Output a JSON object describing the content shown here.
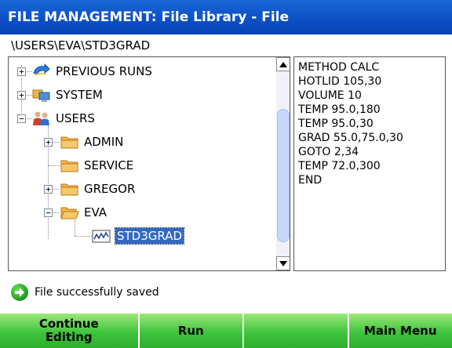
{
  "window": {
    "title": "FILE MANAGEMENT: File Library - File"
  },
  "path": "\\USERS\\EVA\\STD3GRAD",
  "tree": {
    "previous_runs": "PREVIOUS RUNS",
    "system": "SYSTEM",
    "users": "USERS",
    "admin": "ADMIN",
    "service": "SERVICE",
    "gregor": "GREGOR",
    "eva": "EVA",
    "std3grad": "STD3GRAD"
  },
  "method_lines": [
    "METHOD CALC",
    "HOTLID 105,30",
    "VOLUME 10",
    "TEMP 95.0,180",
    "TEMP 95.0,30",
    "GRAD 55.0,75.0,30",
    "GOTO 2,34",
    "TEMP 72.0,300",
    "END"
  ],
  "status": {
    "message": "File successfully saved",
    "icon": "arrow-right-icon"
  },
  "footer": {
    "continue_editing": "Continue Editing",
    "run": "Run",
    "empty": "",
    "main_menu": "Main Menu"
  },
  "colors": {
    "title_bar": "#0b4fc4",
    "selection": "#316ac5",
    "button_green": "#3fc43d",
    "folder": "#f0a830"
  }
}
